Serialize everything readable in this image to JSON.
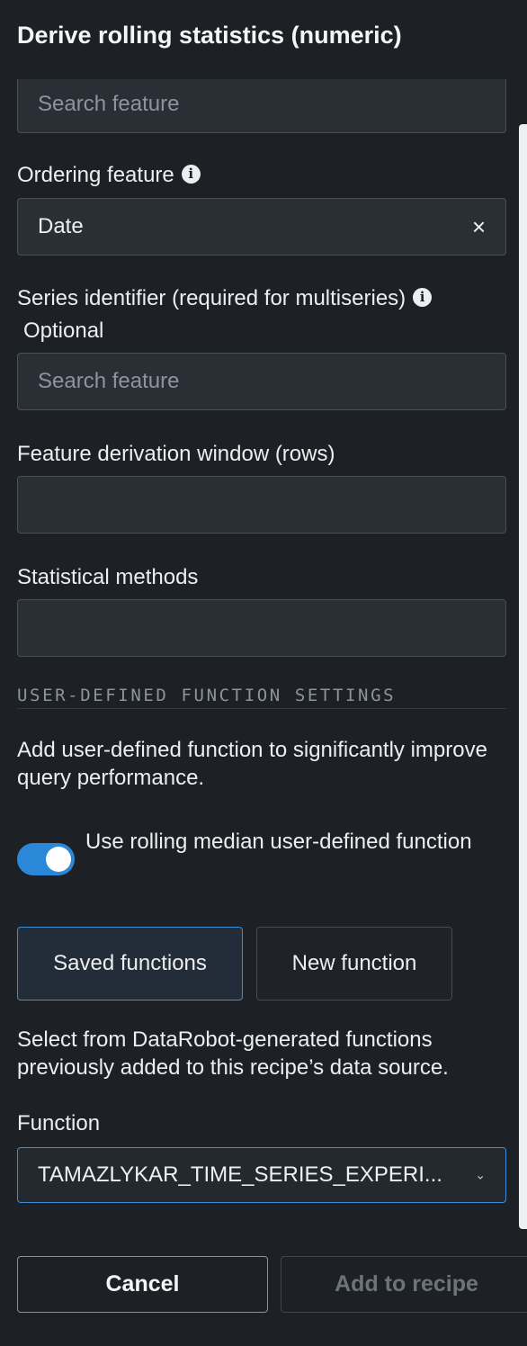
{
  "panel": {
    "title": "Derive rolling statistics (numeric)"
  },
  "fields": {
    "feature_search": {
      "placeholder": "Search feature"
    },
    "ordering": {
      "label": "Ordering feature",
      "value": "Date",
      "clear_icon": "close-icon",
      "info_icon": "info-icon"
    },
    "series_id": {
      "label": "Series identifier (required for multiseries)",
      "optional": "Optional",
      "placeholder": "Search feature",
      "info_icon": "info-icon"
    },
    "window": {
      "label": "Feature derivation window (rows)",
      "value": ""
    },
    "methods": {
      "label": "Statistical methods",
      "value": ""
    }
  },
  "udf": {
    "heading": "USER-DEFINED FUNCTION SETTINGS",
    "description": "Add user-defined function to significantly improve query performance.",
    "toggle": {
      "label": "Use rolling median user-defined function",
      "on": true
    },
    "tabs": [
      {
        "label": "Saved functions",
        "selected": true
      },
      {
        "label": "New function",
        "selected": false
      }
    ],
    "tab_description": "Select from DataRobot-generated functions previously added to this recipe’s data source.",
    "function": {
      "label": "Function",
      "value": "TAMAZLYKAR_TIME_SERIES_EXPERI...",
      "chevron_icon": "chevron-down-icon"
    }
  },
  "footer": {
    "cancel": "Cancel",
    "add": "Add to recipe"
  },
  "colors": {
    "background": "#1d2126",
    "accent": "#2b88d8",
    "field": "#2a2f35"
  }
}
